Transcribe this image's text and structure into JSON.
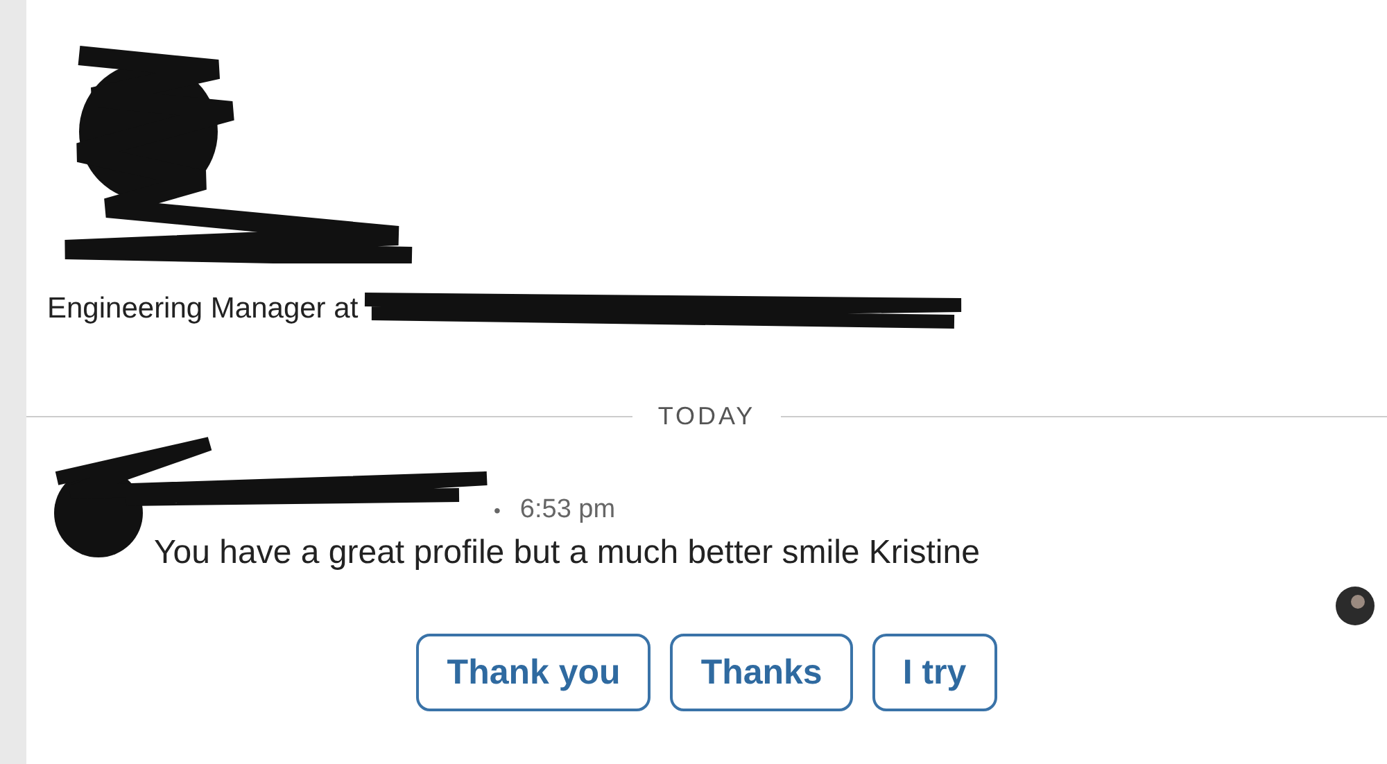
{
  "profile": {
    "headline": "Engineering Manager at"
  },
  "divider": {
    "label": "TODAY"
  },
  "message": {
    "separator": "•",
    "time": "6:53 pm",
    "text": "You have a great profile but a much better smile Kristine"
  },
  "quick_replies": [
    "Thank you",
    "Thanks",
    "I try"
  ]
}
